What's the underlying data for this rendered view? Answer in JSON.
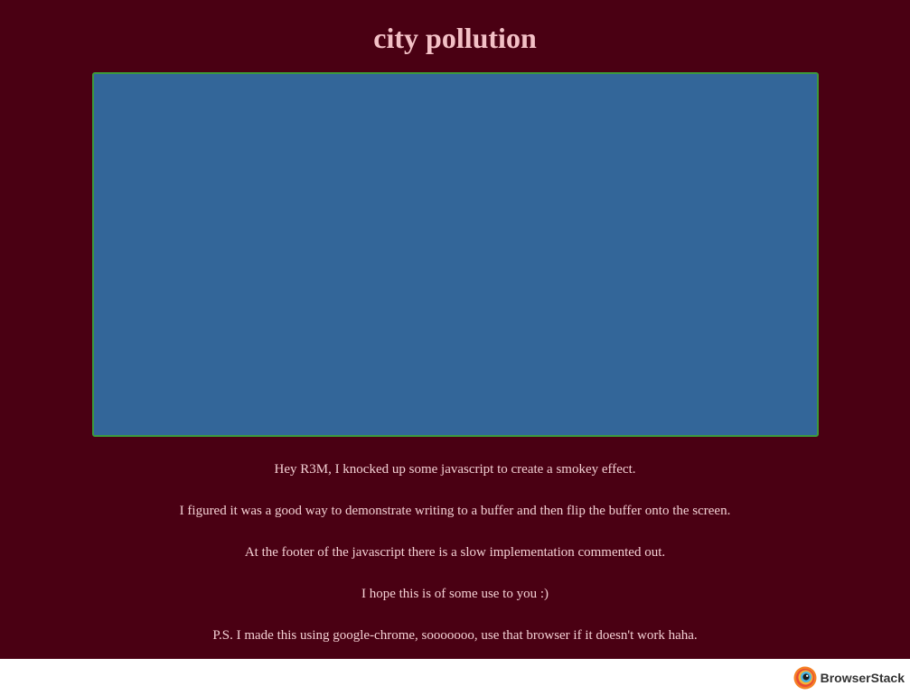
{
  "page": {
    "title": "city pollution",
    "paragraphs": [
      "Hey R3M, I knocked up some javascript to create a smokey effect.",
      "I figured it was a good way to demonstrate writing to a buffer and then flip the buffer onto the screen.",
      "At the footer of the javascript there is a slow implementation commented out.",
      "I hope this is of some use to you :)",
      "P.S. I made this using google-chrome, sooooooo, use that browser if it doesn't work haha."
    ]
  },
  "footer": {
    "brand_label": "BrowserStack"
  },
  "colors": {
    "background": "#4a0013",
    "canvas_fill": "#336699",
    "canvas_border": "#3d9a3d",
    "title_text": "#f3c0c6",
    "body_text": "#f3cfd3"
  },
  "icons": {
    "brand": "browserstack-logo-icon"
  }
}
